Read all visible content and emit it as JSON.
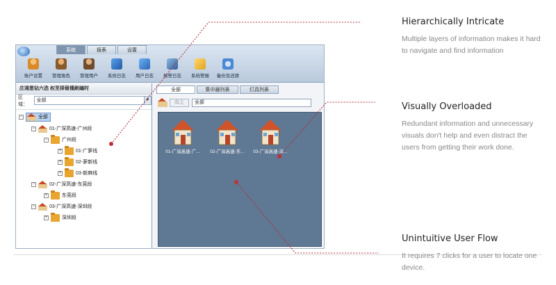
{
  "app": {
    "tabs": [
      "系统",
      "报表",
      "设置"
    ],
    "toolbar": [
      {
        "label": "账户设置",
        "icon": "user-settings-icon",
        "color": "#d98a2a"
      },
      {
        "label": "管理角色",
        "icon": "role-icon",
        "color": "#c27a2a"
      },
      {
        "label": "管理用户",
        "icon": "users-icon",
        "color": "#a8703a"
      },
      {
        "label": "系统日志",
        "icon": "system-log-icon",
        "color": "#2e6fc2"
      },
      {
        "label": "用户日志",
        "icon": "user-log-icon",
        "color": "#3b7ad0"
      },
      {
        "label": "报警日志",
        "icon": "alarm-log-icon",
        "color": "#2f5f9a"
      },
      {
        "label": "系统警报",
        "icon": "system-alert-icon",
        "color": "#e0a41f"
      },
      {
        "label": "备份及还原",
        "icon": "backup-restore-icon",
        "color": "#4b88d6"
      }
    ],
    "left_panel": {
      "title": "庄湘恩钻六选 权至择替播刷编时",
      "region_label": "区域：",
      "region_value": "全部"
    },
    "tree": {
      "root": "全部",
      "nodes": [
        {
          "label": "01-广深高速-广州段",
          "level": 1
        },
        {
          "label": "广州段",
          "level": 2
        },
        {
          "label": "01-广萝线",
          "level": 3
        },
        {
          "label": "02-萝新线",
          "level": 3
        },
        {
          "label": "03-新麻线",
          "level": 3
        },
        {
          "label": "02-广深高速-东莞段",
          "level": 1
        },
        {
          "label": "东莞段",
          "level": 2
        },
        {
          "label": "03-广深高速-深圳段",
          "level": 1
        },
        {
          "label": "深圳段",
          "level": 2
        }
      ]
    },
    "right_tabs": [
      "全部",
      "集中器列表",
      "灯具列表"
    ],
    "pathbar": {
      "up_label": "向上",
      "path": "全部"
    },
    "devices": [
      "01-广深高速-广...",
      "02-广深高速-东...",
      "03-广深高速-深..."
    ]
  },
  "annotations": [
    {
      "title": "Hierarchically Intricate",
      "body": "Multiple layers of information makes it hard to navigate and find information"
    },
    {
      "title": "Visually Overloaded",
      "body": "Redundant information and unnecessary visuals don't help and even distract the users from getting their work done."
    },
    {
      "title": "Unintuitive User Flow",
      "body": "It requires 7 clicks for a user to locate one device."
    }
  ],
  "colors": {
    "accent_dot": "#c0303a",
    "canvas": "#5f7893",
    "annotation_text": "#888888"
  }
}
